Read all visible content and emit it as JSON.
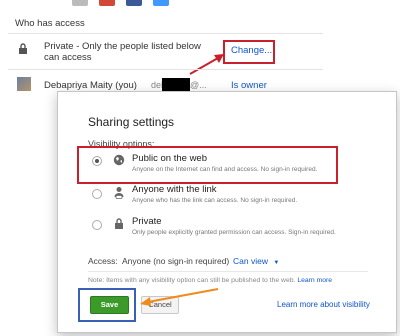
{
  "header": {
    "section_title": "Who has access",
    "social_colors": [
      "#bbbbbb",
      "#d14836",
      "#3b5998",
      "#4099ff"
    ]
  },
  "access_list": {
    "privacy_row": {
      "icon": "lock-icon",
      "text": "Private - Only the people listed below can access",
      "change_link": "Change..."
    },
    "owner_row": {
      "avatar": "avatar",
      "name": "Debapriya Maity (you)",
      "email_prefix": "debapriya",
      "email_suffix": "@...",
      "role": "Is owner"
    }
  },
  "dialog": {
    "title": "Sharing settings",
    "visibility_label": "Visibility options:",
    "options": [
      {
        "title": "Public on the web",
        "desc": "Anyone on the Internet can find and access. No sign-in required.",
        "icon": "globe-icon",
        "selected": true
      },
      {
        "title": "Anyone with the link",
        "desc": "Anyone who has the link can access. No sign-in required.",
        "icon": "person-link-icon",
        "selected": false
      },
      {
        "title": "Private",
        "desc": "Only people explicitly granted permission can access. Sign-in required.",
        "icon": "lock-icon",
        "selected": false
      }
    ],
    "access_label": "Access:  Anyone (no sign-in required)",
    "access_value": "Can view",
    "note": "Note: Items with any visibility option can still be published to the web.",
    "note_link": "Learn more",
    "save_label": "Save",
    "cancel_label": "Cancel",
    "learn_link": "Learn more about visibility"
  },
  "annotations": {
    "red": "#c8212b",
    "orange": "#f08a1c",
    "blue": "#3a5fb5"
  }
}
